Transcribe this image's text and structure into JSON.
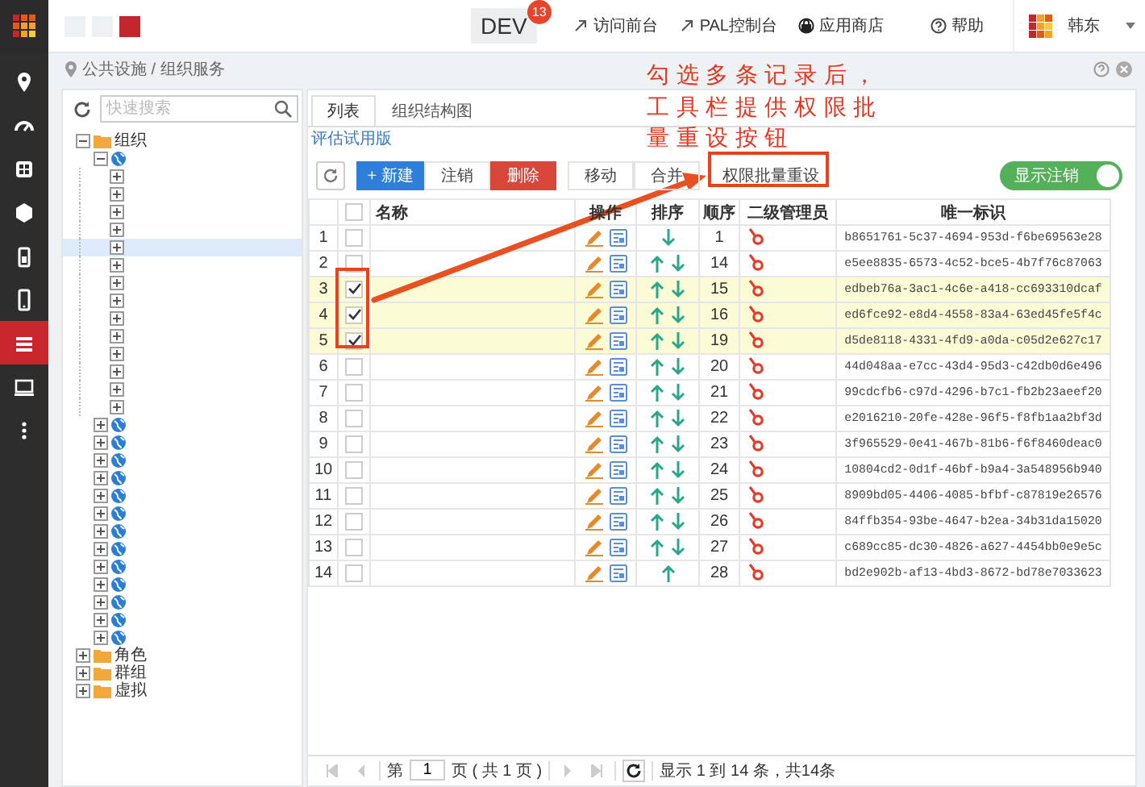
{
  "top_bar": {
    "env": {
      "label": "DEV",
      "count": "13"
    },
    "links": [
      {
        "label": "访问前台",
        "kind": "external"
      },
      {
        "label": "PAL控制台",
        "kind": "external"
      },
      {
        "label": "应用商店",
        "kind": "store"
      },
      {
        "label": "帮助",
        "kind": "help"
      }
    ],
    "user": {
      "name": "韩东"
    }
  },
  "sidebar": {
    "items": [
      {
        "kind": "pin",
        "selected": false
      },
      {
        "kind": "gauge",
        "selected": false
      },
      {
        "kind": "film",
        "selected": false
      },
      {
        "kind": "cube",
        "selected": false
      },
      {
        "kind": "battery",
        "selected": false
      },
      {
        "kind": "mobile",
        "selected": false
      },
      {
        "kind": "list",
        "selected": true
      },
      {
        "kind": "monitor",
        "selected": false
      },
      {
        "kind": "more",
        "selected": false
      }
    ]
  },
  "breadcrumb": "公共设施 / 组织服务",
  "tree": {
    "search": {
      "placeholder": "快速搜索"
    },
    "nodes": [
      {
        "kind": "folder",
        "label": "组织",
        "expanded": true,
        "selected": false,
        "children": [
          {
            "kind": "globe",
            "expanded": true,
            "selected": false,
            "children": [
              {
                "kind": "leaf",
                "expanded": false,
                "selected": false
              },
              {
                "kind": "leaf",
                "expanded": false,
                "selected": false
              },
              {
                "kind": "leaf",
                "expanded": false,
                "selected": false
              },
              {
                "kind": "leaf",
                "expanded": false,
                "selected": false
              },
              {
                "kind": "leaf",
                "expanded": false,
                "selected": true
              },
              {
                "kind": "leaf",
                "expanded": false,
                "selected": false
              },
              {
                "kind": "leaf",
                "expanded": false,
                "selected": false
              },
              {
                "kind": "leaf",
                "expanded": false,
                "selected": false
              },
              {
                "kind": "leaf",
                "expanded": false,
                "selected": false
              },
              {
                "kind": "leaf",
                "expanded": false,
                "selected": false
              },
              {
                "kind": "leaf",
                "expanded": false,
                "selected": false
              },
              {
                "kind": "leaf",
                "expanded": false,
                "selected": false
              },
              {
                "kind": "leaf",
                "expanded": false,
                "selected": false
              },
              {
                "kind": "leaf",
                "expanded": false,
                "selected": false
              }
            ]
          },
          {
            "kind": "globe",
            "expanded": false,
            "selected": false
          },
          {
            "kind": "globe",
            "expanded": false,
            "selected": false
          },
          {
            "kind": "globe",
            "expanded": false,
            "selected": false
          },
          {
            "kind": "globe",
            "expanded": false,
            "selected": false
          },
          {
            "kind": "globe",
            "expanded": false,
            "selected": false
          },
          {
            "kind": "globe",
            "expanded": false,
            "selected": false
          },
          {
            "kind": "globe",
            "expanded": false,
            "selected": false
          },
          {
            "kind": "globe",
            "expanded": false,
            "selected": false
          },
          {
            "kind": "globe",
            "expanded": false,
            "selected": false
          },
          {
            "kind": "globe",
            "expanded": false,
            "selected": false
          },
          {
            "kind": "globe",
            "expanded": false,
            "selected": false
          },
          {
            "kind": "globe",
            "expanded": false,
            "selected": false
          },
          {
            "kind": "globe",
            "expanded": false,
            "selected": false
          }
        ]
      },
      {
        "kind": "folder",
        "label": "角色",
        "expanded": false,
        "selected": false
      },
      {
        "kind": "folder",
        "label": "群组",
        "expanded": false,
        "selected": false
      },
      {
        "kind": "folder",
        "label": "虚拟",
        "expanded": false,
        "selected": false
      }
    ]
  },
  "tabs": [
    {
      "label": "列表",
      "selected": true
    },
    {
      "label": "组织结构图",
      "selected": false
    }
  ],
  "trial_link": "评估试用版",
  "toolbar": {
    "groups": [
      [
        {
          "label": "+ 新建",
          "kind": "primary"
        },
        {
          "label": "注销",
          "kind": "plain"
        },
        {
          "label": "删除",
          "kind": "danger"
        }
      ],
      [
        {
          "label": "移动",
          "kind": "plain"
        },
        {
          "label": "合并",
          "kind": "plain"
        }
      ],
      [
        {
          "label": "权限批量重设",
          "kind": "flat"
        }
      ]
    ],
    "toggle": {
      "label": "显示注销",
      "on": true
    }
  },
  "table": {
    "all_selected": false,
    "columns": [
      "名称",
      "操作",
      "排序",
      "顺序",
      "二级管理员",
      "唯一标识"
    ],
    "rows": [
      {
        "number": "1",
        "selected": false,
        "up": false,
        "down": true,
        "order": "1",
        "id": "b8651761-5c37-4694-953d-f6be69563e28"
      },
      {
        "number": "2",
        "selected": false,
        "up": true,
        "down": true,
        "order": "14",
        "id": "e5ee8835-6573-4c52-bce5-4b7f76c87063"
      },
      {
        "number": "3",
        "selected": true,
        "up": true,
        "down": true,
        "order": "15",
        "id": "edbeb76a-3ac1-4c6e-a418-cc693310dcaf"
      },
      {
        "number": "4",
        "selected": true,
        "up": true,
        "down": true,
        "order": "16",
        "id": "ed6fce92-e8d4-4558-83a4-63ed45fe5f4c"
      },
      {
        "number": "5",
        "selected": true,
        "up": true,
        "down": true,
        "order": "19",
        "id": "d5de8118-4331-4fd9-a0da-c05d2e627c17"
      },
      {
        "number": "6",
        "selected": false,
        "up": true,
        "down": true,
        "order": "20",
        "id": "44d048aa-e7cc-43d4-95d3-c42db0d6e496"
      },
      {
        "number": "7",
        "selected": false,
        "up": true,
        "down": true,
        "order": "21",
        "id": "99cdcfb6-c97d-4296-b7c1-fb2b23aeef20"
      },
      {
        "number": "8",
        "selected": false,
        "up": true,
        "down": true,
        "order": "22",
        "id": "e2016210-20fe-428e-96f5-f8fb1aa2bf3d"
      },
      {
        "number": "9",
        "selected": false,
        "up": true,
        "down": true,
        "order": "23",
        "id": "3f965529-0e41-467b-81b6-f6f8460deac0"
      },
      {
        "number": "10",
        "selected": false,
        "up": true,
        "down": true,
        "order": "24",
        "id": "10804cd2-0d1f-46bf-b9a4-3a548956b940"
      },
      {
        "number": "11",
        "selected": false,
        "up": true,
        "down": true,
        "order": "25",
        "id": "8909bd05-4406-4085-bfbf-c87819e26576"
      },
      {
        "number": "12",
        "selected": false,
        "up": true,
        "down": true,
        "order": "26",
        "id": "84ffb354-93be-4647-b2ea-34b31da15020"
      },
      {
        "number": "13",
        "selected": false,
        "up": true,
        "down": true,
        "order": "27",
        "id": "c689cc85-dc30-4826-a627-4454bb0e9e5c"
      },
      {
        "number": "14",
        "selected": false,
        "up": true,
        "down": false,
        "order": "28",
        "id": "bd2e902b-af13-4bd3-8672-bd78e7033623"
      }
    ]
  },
  "pager": {
    "page_prefix": "第",
    "page": "1",
    "page_suffix": "页 ( 共 1 页 )",
    "summary": "显示 1 到 14 条，共14条"
  },
  "annotation": {
    "lines": [
      "勾选多条记录后，",
      "工具栏提供权限批",
      "量重设按钮"
    ]
  }
}
